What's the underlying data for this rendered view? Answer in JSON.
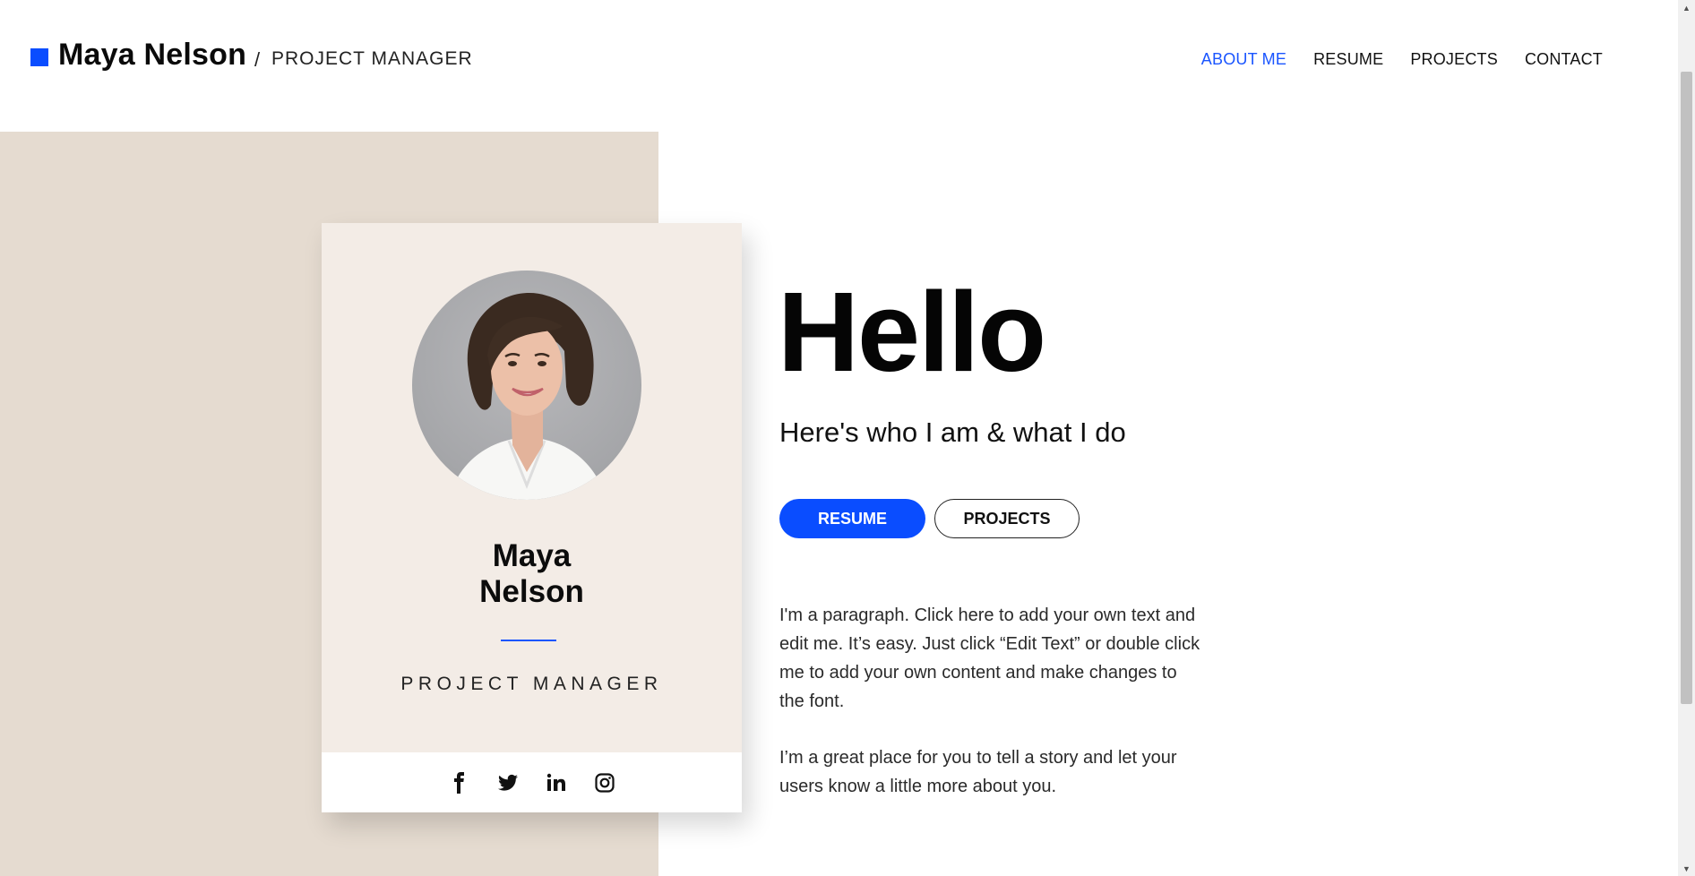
{
  "header": {
    "brand_name": "Maya Nelson",
    "separator": "/",
    "brand_role": "PROJECT MANAGER",
    "nav": [
      {
        "label": "ABOUT ME",
        "active": true
      },
      {
        "label": "RESUME",
        "active": false
      },
      {
        "label": "PROJECTS",
        "active": false
      },
      {
        "label": "CONTACT",
        "active": false
      }
    ]
  },
  "card": {
    "name_line1": "Maya",
    "name_line2": "Nelson",
    "role": "PROJECT MANAGER",
    "social_icons": [
      "facebook-icon",
      "twitter-icon",
      "linkedin-icon",
      "instagram-icon"
    ]
  },
  "main": {
    "heading": "Hello",
    "subtitle": "Here's who I am & what I do",
    "buttons": {
      "resume": "RESUME",
      "projects": "PROJECTS"
    },
    "paragraph1": "I'm a paragraph. Click here to add your own text and edit me. It’s easy. Just click “Edit Text” or double click me to add your own content and make changes to the font.",
    "paragraph2": "I’m a great place for you to tell a story and let your users know a little more about you."
  },
  "colors": {
    "accent": "#0a4dff",
    "panel": "#e5dbd0",
    "card": "#f3ece6"
  }
}
